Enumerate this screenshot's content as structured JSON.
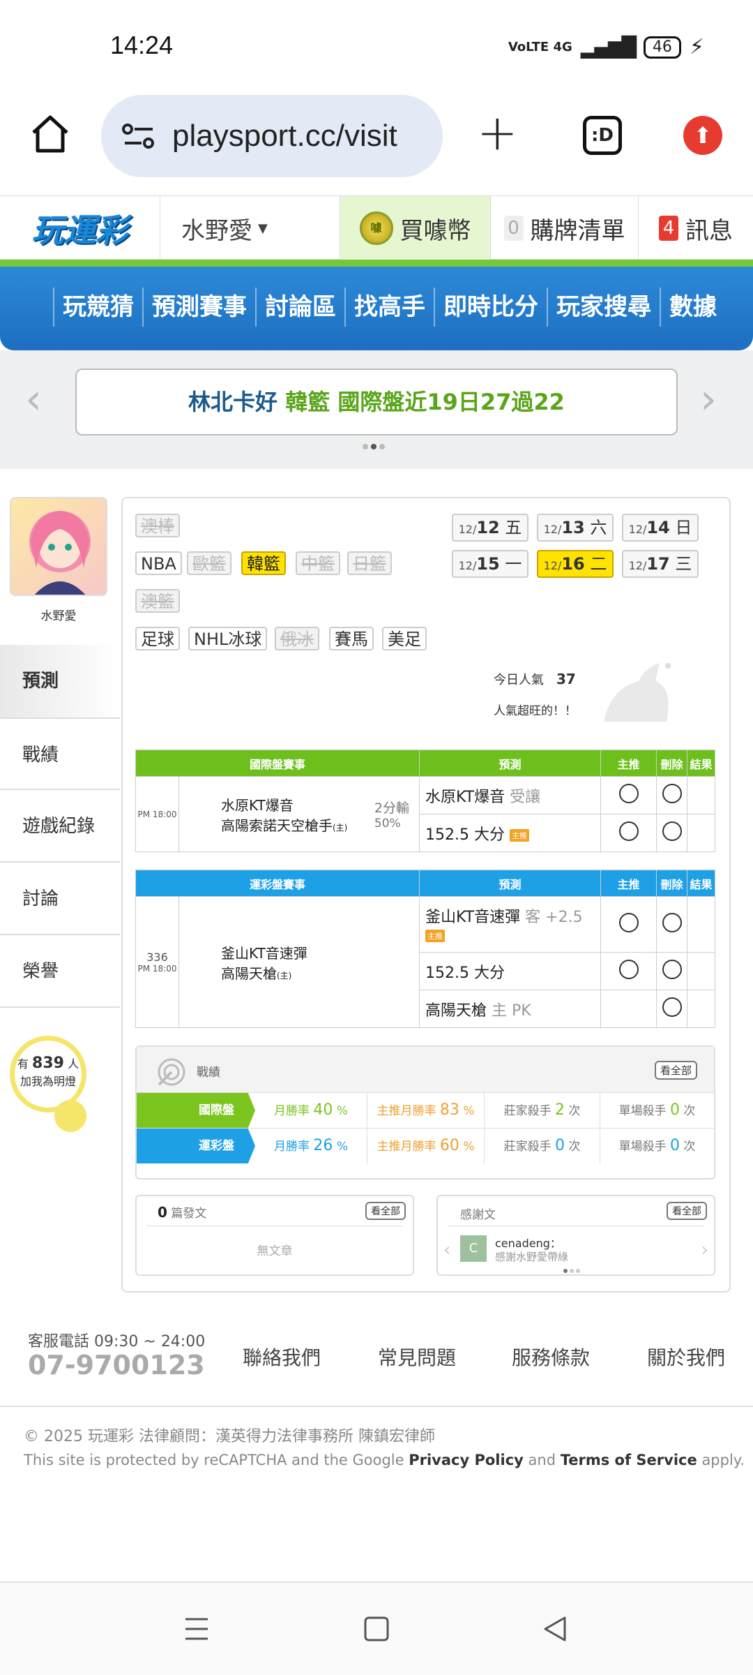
{
  "status": {
    "time": "14:24",
    "network": "VoLTE 4G",
    "battery": "46"
  },
  "browser": {
    "url": "playsport.cc/visit",
    "tabs_label": ":D"
  },
  "header": {
    "logo": "玩運彩",
    "username": "水野愛",
    "coin_label": "買噱幣",
    "coin_icon_text": "噱",
    "cart_count": "0",
    "cart_label": "購牌清單",
    "msg_count": "4",
    "msg_label": "訊息"
  },
  "nav": [
    "玩競猜",
    "預測賽事",
    "討論區",
    "找高手",
    "即時比分",
    "玩家搜尋",
    "數據"
  ],
  "ticker": {
    "name": "林北卡好",
    "sport": "韓籃",
    "text": "國際盤近19日27過22"
  },
  "profile": {
    "name": "水野愛"
  },
  "sidebar": [
    "預測",
    "戰績",
    "遊戲紀錄",
    "討論",
    "榮譽"
  ],
  "fans": {
    "prefix": "有",
    "count": "839",
    "suffix": "人",
    "line2": "加我為明燈"
  },
  "sports": {
    "row0": [
      {
        "label": "澳棒",
        "state": "disabled"
      }
    ],
    "row1": [
      {
        "label": "NBA",
        "state": "normal"
      },
      {
        "label": "歐籃",
        "state": "disabled"
      },
      {
        "label": "韓籃",
        "state": "selected"
      },
      {
        "label": "中籃",
        "state": "disabled"
      },
      {
        "label": "日籃",
        "state": "disabled"
      }
    ],
    "row2": [
      {
        "label": "澳籃",
        "state": "disabled"
      }
    ],
    "row3": [
      {
        "label": "足球",
        "state": "normal"
      },
      {
        "label": "NHL冰球",
        "state": "normal"
      },
      {
        "label": "俄冰",
        "state": "disabled"
      },
      {
        "label": "賽馬",
        "state": "normal"
      },
      {
        "label": "美足",
        "state": "normal"
      }
    ]
  },
  "dates": [
    {
      "pre": "12/",
      "day": "12",
      "wd": "五"
    },
    {
      "pre": "12/",
      "day": "13",
      "wd": "六"
    },
    {
      "pre": "12/",
      "day": "14",
      "wd": "日"
    },
    {
      "pre": "12/",
      "day": "15",
      "wd": "一"
    },
    {
      "pre": "12/",
      "day": "16",
      "wd": "二"
    },
    {
      "pre": "12/",
      "day": "17",
      "wd": "三"
    }
  ],
  "popularity": {
    "label": "今日人氣",
    "value": "37",
    "note": "人氣超旺的！！"
  },
  "intl": {
    "headers": [
      "國際盤賽事",
      "預測",
      "主推",
      "刪除",
      "結果"
    ],
    "time": "PM 18:00",
    "home": "水原KT爆音",
    "away": "高陽索諾天空槍手",
    "away_tag": "(主)",
    "line": "2分輸",
    "pct": "50%",
    "picks": [
      {
        "main": "水原KT爆音",
        "sub": "受讓",
        "tag": ""
      },
      {
        "main": "152.5 大分",
        "sub": "",
        "tag": "主推"
      }
    ]
  },
  "lottery": {
    "headers": [
      "運彩盤賽事",
      "預測",
      "主推",
      "刪除",
      "結果"
    ],
    "no": "336",
    "time": "PM 18:00",
    "home": "釜山KT音速彈",
    "away": "高陽天槍",
    "away_tag": "(主)",
    "picks": [
      {
        "main": "釜山KT音速彈",
        "sub": "客 +2.5",
        "tag": "主推"
      },
      {
        "main": "152.5 大分",
        "sub": "",
        "tag": ""
      },
      {
        "main": "高陽天槍",
        "sub": "主 PK",
        "tag": ""
      }
    ]
  },
  "record": {
    "title": "戰績",
    "view_all": "看全部",
    "rows": [
      {
        "label": "國際盤",
        "color": "#7cc51f",
        "month_label": "月勝率",
        "month": "40",
        "main_label": "主推月勝率",
        "main": "83",
        "pct": "%",
        "killer_label": "莊家殺手",
        "killer": "2",
        "single_label": "單場殺手",
        "single": "0",
        "unit": "次"
      },
      {
        "label": "運彩盤",
        "color": "#1ea0e6",
        "month_label": "月勝率",
        "month": "26",
        "main_label": "主推月勝率",
        "main": "60",
        "pct": "%",
        "killer_label": "莊家殺手",
        "killer": "0",
        "single_label": "單場殺手",
        "single": "0",
        "unit": "次"
      }
    ]
  },
  "posts": {
    "count": "0",
    "label": "篇發文",
    "view_all": "看全部",
    "empty": "無文章"
  },
  "thanks": {
    "label": "感謝文",
    "view_all": "看全部",
    "avatar_letter": "C",
    "user": "cenadeng：",
    "text": "感謝水野愛帶綠"
  },
  "footer": {
    "phone_label": "客服電話 09:30 ~ 24:00",
    "phone": "07-9700123",
    "links": [
      "聯絡我們",
      "常見問題",
      "服務條款",
      "關於我們"
    ],
    "copyright": "© 2025 玩運彩 法律顧問：漢英得力法律事務所 陳鎮宏律師",
    "recaptcha_pre": "This site is protected by reCAPTCHA and the Google",
    "privacy": "Privacy Policy",
    "and": "and",
    "terms": "Terms of Service",
    "apply": "apply."
  },
  "colors": {
    "green": "#6dbf1c",
    "blue": "#1ea0e6",
    "yellow": "#ffe200",
    "red": "#e63b2e"
  }
}
